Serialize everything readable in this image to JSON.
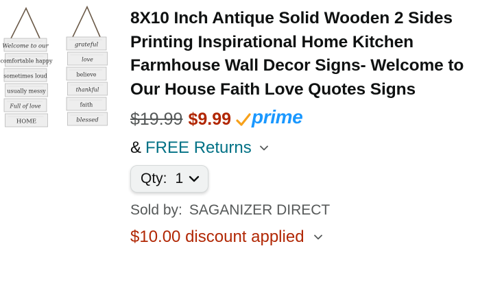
{
  "product": {
    "title": "8X10 Inch Antique Solid Wooden 2 Sides Printing Inspirational Home Kitchen Farmhouse Wall Decor Signs- Welcome to Our House Faith Love Quotes Signs",
    "image_alt": "Two wooden wall sign boards",
    "sign_left_lines": [
      "Welcome to our",
      "comfortable happy",
      "sometimes loud",
      "usually messy",
      "Full of love",
      "HOME"
    ],
    "sign_right_lines": [
      "grateful",
      "love",
      "believe",
      "thankful",
      "faith",
      "blessed"
    ]
  },
  "pricing": {
    "list_price": "$19.99",
    "sale_price": "$9.99",
    "prime_label": "prime"
  },
  "returns": {
    "prefix": "&",
    "label": "FREE Returns"
  },
  "quantity": {
    "label": "Qty:",
    "value": "1"
  },
  "seller": {
    "label": "Sold by:",
    "name": "SAGANIZER DIRECT"
  },
  "discount": {
    "label": "$10.00 discount applied"
  },
  "colors": {
    "price_red": "#b12704",
    "link_teal": "#007185",
    "prime_blue": "#1a98ff",
    "prime_check_orange": "#f7a11a"
  },
  "icons": {
    "prime_check": "checkmark-icon",
    "returns_toggle": "chevron-down-icon",
    "qty_toggle": "chevron-down-icon",
    "discount_toggle": "chevron-down-icon"
  }
}
